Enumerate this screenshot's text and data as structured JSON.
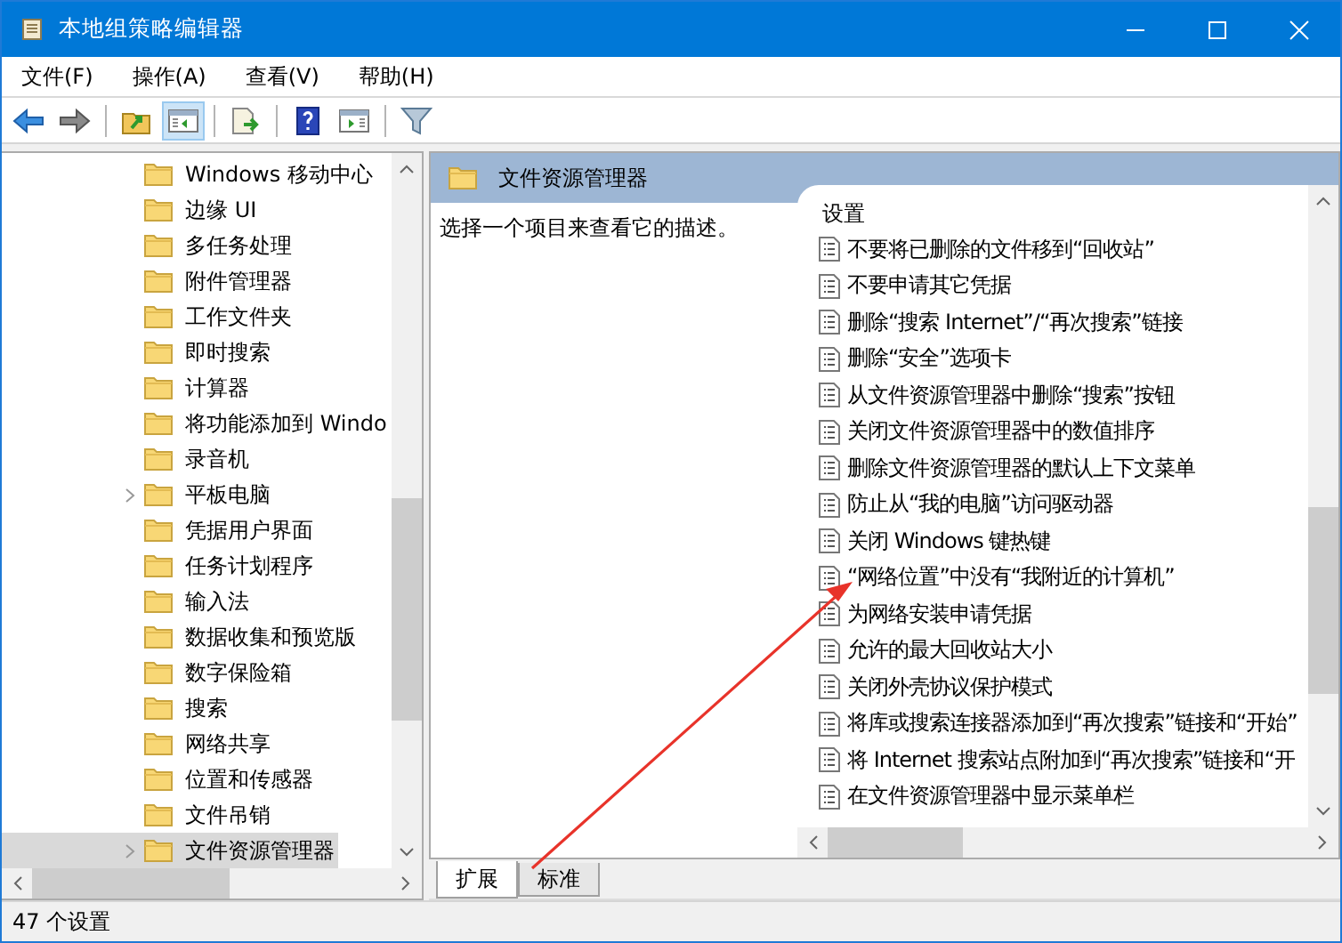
{
  "window": {
    "title": "本地组策略编辑器"
  },
  "menu": [
    "文件(F)",
    "操作(A)",
    "查看(V)",
    "帮助(H)"
  ],
  "toolbar": [
    [
      {
        "kind": "back",
        "pressed": false
      },
      {
        "kind": "forward",
        "pressed": false
      }
    ],
    [
      {
        "kind": "up",
        "pressed": false
      },
      {
        "kind": "tree",
        "pressed": true
      }
    ],
    [
      {
        "kind": "export",
        "pressed": false
      }
    ],
    [
      {
        "kind": "help",
        "pressed": false
      },
      {
        "kind": "action",
        "pressed": false
      }
    ],
    [
      {
        "kind": "filter",
        "pressed": false
      }
    ]
  ],
  "tree": {
    "items": [
      {
        "label": "Windows 移动中心",
        "expandable": false,
        "selected": false
      },
      {
        "label": "边缘 UI",
        "expandable": false,
        "selected": false
      },
      {
        "label": "多任务处理",
        "expandable": false,
        "selected": false
      },
      {
        "label": "附件管理器",
        "expandable": false,
        "selected": false
      },
      {
        "label": "工作文件夹",
        "expandable": false,
        "selected": false
      },
      {
        "label": "即时搜索",
        "expandable": false,
        "selected": false
      },
      {
        "label": "计算器",
        "expandable": false,
        "selected": false
      },
      {
        "label": "将功能添加到 Windo",
        "expandable": false,
        "selected": false
      },
      {
        "label": "录音机",
        "expandable": false,
        "selected": false
      },
      {
        "label": "平板电脑",
        "expandable": true,
        "selected": false
      },
      {
        "label": "凭据用户界面",
        "expandable": false,
        "selected": false
      },
      {
        "label": "任务计划程序",
        "expandable": false,
        "selected": false
      },
      {
        "label": "输入法",
        "expandable": false,
        "selected": false
      },
      {
        "label": "数据收集和预览版",
        "expandable": false,
        "selected": false
      },
      {
        "label": "数字保险箱",
        "expandable": false,
        "selected": false
      },
      {
        "label": "搜索",
        "expandable": false,
        "selected": false
      },
      {
        "label": "网络共享",
        "expandable": false,
        "selected": false
      },
      {
        "label": "位置和传感器",
        "expandable": false,
        "selected": false
      },
      {
        "label": "文件吊销",
        "expandable": false,
        "selected": false
      },
      {
        "label": "文件资源管理器",
        "expandable": true,
        "selected": true
      }
    ]
  },
  "details": {
    "title": "文件资源管理器",
    "description": "选择一个项目来查看它的描述。",
    "column_header": "设置",
    "settings": [
      "不要将已删除的文件移到“回收站”",
      "不要申请其它凭据",
      "删除“搜索 Internet”/“再次搜索”链接",
      "删除“安全”选项卡",
      "从文件资源管理器中删除“搜索”按钮",
      "关闭文件资源管理器中的数值排序",
      "删除文件资源管理器的默认上下文菜单",
      "防止从“我的电脑”访问驱动器",
      "关闭 Windows 键热键",
      "“网络位置”中没有“我附近的计算机”",
      "为网络安装申请凭据",
      "允许的最大回收站大小",
      "关闭外壳协议保护模式",
      "将库或搜索连接器添加到“再次搜索”链接和“开始”",
      "将 Internet 搜索站点附加到“再次搜索”链接和“开",
      "在文件资源管理器中显示菜单栏"
    ]
  },
  "tabs": [
    {
      "label": "扩展",
      "selected": true
    },
    {
      "label": "标准",
      "selected": false
    }
  ],
  "status_bar": "47 个设置"
}
